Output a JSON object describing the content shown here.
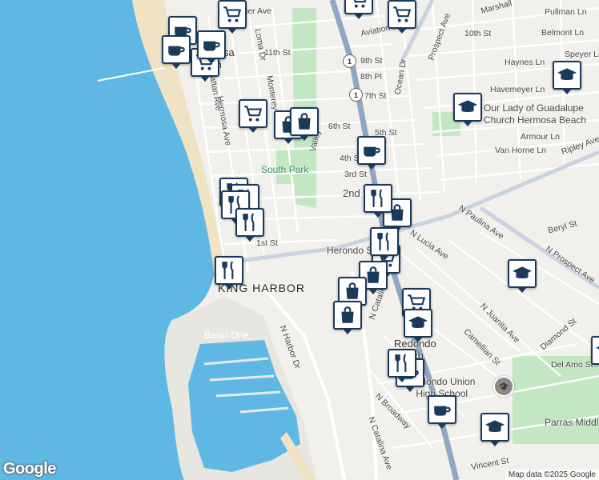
{
  "attribution": "Map data ©2025 Google",
  "logo": "Google",
  "colors": {
    "water": "#5fb8e4",
    "sand": "#efe3c4",
    "park": "#c3e6c3",
    "road_major": "#8fa7c4",
    "marker_border": "#1a3a5c"
  },
  "area_labels": {
    "king_harbor": "KING HARBOR",
    "basin_one": "Basin One",
    "south_park": "South Park",
    "redondo_beach": "Redondo\nBeach",
    "hermosa_beach": "Hermosa\nBeach",
    "church": "Our Lady of Guadalupe\nChurch Hermosa Beach",
    "redondo_union": "Redondo Union\nHigh School",
    "parras_middle": "Parras Middle"
  },
  "street_labels": [
    "Pier Ave",
    "Aviation Blvd",
    "11th St",
    "10th St",
    "9th St",
    "8th Pl",
    "7th St",
    "6th St",
    "5th St",
    "4th St",
    "3rd St",
    "2nd St",
    "1st St",
    "Pullman Ln",
    "Belmont Ln",
    "Marshall",
    "Speyer Ln",
    "Haynes Ln",
    "Havemeyer Ln",
    "Armour Ln",
    "Van Horne Ln",
    "Ripley Ave",
    "Prospect Ave",
    "Ocean Dr",
    "Loma Dr",
    "Manhattan Ave",
    "Hermosa Ave",
    "Valley",
    "Monterey",
    "Herondo St",
    "N Lucia Ave",
    "N Paulina Ave",
    "Beryl St",
    "N Prospect Ave",
    "N Juanita Ave",
    "Camellian St",
    "Diamond St",
    "Del Amo St",
    "N Harbor Dr",
    "N Catalina Ave",
    "N Broadway",
    "Vincent St",
    "N Catalina"
  ],
  "route_shield": "1",
  "markers": [
    {
      "type": "store",
      "label": "cart-store"
    },
    {
      "type": "coffee",
      "label": "coffee-shop"
    },
    {
      "type": "shopping",
      "label": "shopping-bag"
    },
    {
      "type": "restaurant",
      "label": "restaurant"
    },
    {
      "type": "school",
      "label": "school"
    }
  ]
}
